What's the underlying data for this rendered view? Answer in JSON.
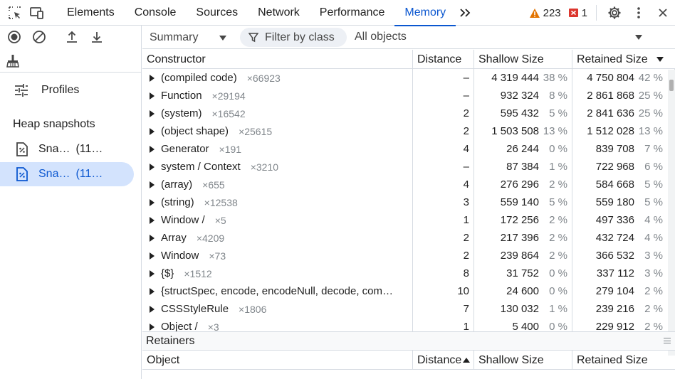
{
  "tabs": [
    {
      "label": "Elements"
    },
    {
      "label": "Console"
    },
    {
      "label": "Sources"
    },
    {
      "label": "Network"
    },
    {
      "label": "Performance"
    },
    {
      "label": "Memory"
    }
  ],
  "warnings_count": "223",
  "errors_count": "1",
  "sidebar": {
    "profiles_label": "Profiles",
    "heap_snapshots_label": "Heap snapshots",
    "snapshots": [
      {
        "name": "Sna…",
        "size": "(11…"
      },
      {
        "name": "Sna…",
        "size": "(11…"
      }
    ]
  },
  "toolbar": {
    "view_select": "Summary",
    "filter_placeholder": "Filter by class",
    "objects_select": "All objects"
  },
  "table": {
    "headers": [
      "Constructor",
      "Distance",
      "Shallow Size",
      "Retained Size"
    ],
    "rows": [
      {
        "name": "(compiled code)",
        "count": "×66923",
        "distance": "–",
        "shallow": "4 319 444",
        "shallow_pct": "38 %",
        "retained": "4 750 804",
        "retained_pct": "42 %"
      },
      {
        "name": "Function",
        "count": "×29194",
        "distance": "–",
        "shallow": "932 324",
        "shallow_pct": "8 %",
        "retained": "2 861 868",
        "retained_pct": "25 %"
      },
      {
        "name": "(system)",
        "count": "×16542",
        "distance": "2",
        "shallow": "595 432",
        "shallow_pct": "5 %",
        "retained": "2 841 636",
        "retained_pct": "25 %"
      },
      {
        "name": "(object shape)",
        "count": "×25615",
        "distance": "2",
        "shallow": "1 503 508",
        "shallow_pct": "13 %",
        "retained": "1 512 028",
        "retained_pct": "13 %"
      },
      {
        "name": "Generator",
        "count": "×191",
        "distance": "4",
        "shallow": "26 244",
        "shallow_pct": "0 %",
        "retained": "839 708",
        "retained_pct": "7 %"
      },
      {
        "name": "system / Context",
        "count": "×3210",
        "distance": "–",
        "shallow": "87 384",
        "shallow_pct": "1 %",
        "retained": "722 968",
        "retained_pct": "6 %"
      },
      {
        "name": "(array)",
        "count": "×655",
        "distance": "4",
        "shallow": "276 296",
        "shallow_pct": "2 %",
        "retained": "584 668",
        "retained_pct": "5 %"
      },
      {
        "name": "(string)",
        "count": "×12538",
        "distance": "3",
        "shallow": "559 140",
        "shallow_pct": "5 %",
        "retained": "559 180",
        "retained_pct": "5 %"
      },
      {
        "name": "Window /",
        "count": "×5",
        "distance": "1",
        "shallow": "172 256",
        "shallow_pct": "2 %",
        "retained": "497 336",
        "retained_pct": "4 %"
      },
      {
        "name": "Array",
        "count": "×4209",
        "distance": "2",
        "shallow": "217 396",
        "shallow_pct": "2 %",
        "retained": "432 724",
        "retained_pct": "4 %"
      },
      {
        "name": "Window",
        "count": "×73",
        "distance": "2",
        "shallow": "239 864",
        "shallow_pct": "2 %",
        "retained": "366 532",
        "retained_pct": "3 %"
      },
      {
        "name": "{$}",
        "count": "×1512",
        "distance": "8",
        "shallow": "31 752",
        "shallow_pct": "0 %",
        "retained": "337 112",
        "retained_pct": "3 %"
      },
      {
        "name": "{structSpec, encode, encodeNull, decode, com…",
        "count": "",
        "distance": "10",
        "shallow": "24 600",
        "shallow_pct": "0 %",
        "retained": "279 104",
        "retained_pct": "2 %"
      },
      {
        "name": "CSSStyleRule",
        "count": "×1806",
        "distance": "7",
        "shallow": "130 032",
        "shallow_pct": "1 %",
        "retained": "239 216",
        "retained_pct": "2 %"
      },
      {
        "name": "Object /",
        "count": "×3",
        "distance": "1",
        "shallow": "5 400",
        "shallow_pct": "0 %",
        "retained": "229 912",
        "retained_pct": "2 %"
      }
    ]
  },
  "retainers": {
    "title": "Retainers",
    "headers": [
      "Object",
      "Distance",
      "Shallow Size",
      "Retained Size"
    ]
  }
}
